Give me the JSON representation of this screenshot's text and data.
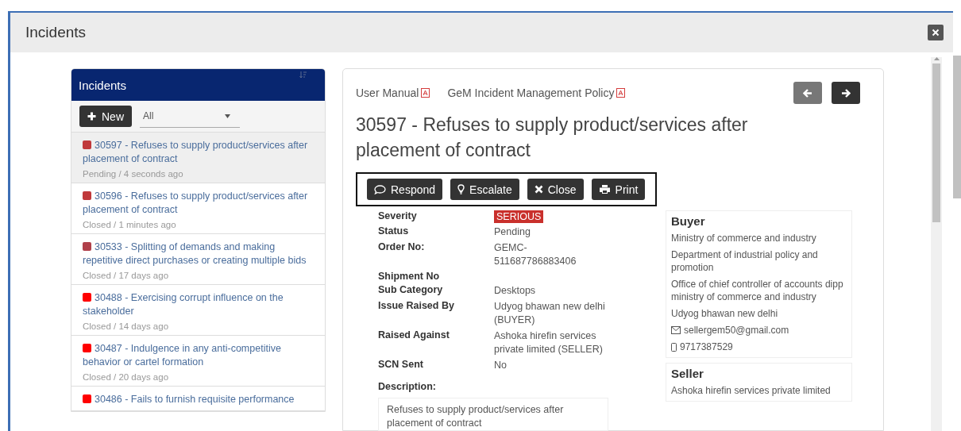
{
  "window": {
    "title": "Incidents"
  },
  "incident_list": {
    "title": "Incidents",
    "new_button": "New",
    "filter": {
      "value": "All"
    },
    "items": [
      {
        "title": "30597 - Refuses to supply product/services after placement of contract",
        "meta": "Pending / 4 seconds ago",
        "color": "#c0393b",
        "selected": true
      },
      {
        "title": "30596 - Refuses to supply product/services after placement of contract",
        "meta": "Closed / 1 minutes ago",
        "color": "#c0393b",
        "selected": false
      },
      {
        "title": "30533 - Splitting of demands and making repetitive direct purchases or creating multiple bids",
        "meta": "Closed / 17 days ago",
        "color": "#b0404a",
        "selected": false
      },
      {
        "title": "30488 - Exercising corrupt influence on the stakeholder",
        "meta": "Closed / 14 days ago",
        "color": "#ff0000",
        "selected": false
      },
      {
        "title": "30487 - Indulgence in any anti-competitive behavior or cartel formation",
        "meta": "Closed / 20 days ago",
        "color": "#ff0000",
        "selected": false
      },
      {
        "title": "30486 - Fails to furnish requisite performance",
        "color": "#ff0000",
        "selected": false
      }
    ]
  },
  "detail": {
    "links": [
      "User Manual",
      "GeM Incident Management Policy"
    ],
    "nav": [
      {
        "kind": "prev",
        "disabled": true
      },
      {
        "kind": "next",
        "disabled": false
      }
    ],
    "title": "30597 - Refuses to supply product/services after placement of contract",
    "actions": [
      {
        "label": "Respond",
        "kind": "respond"
      },
      {
        "label": "Escalate",
        "kind": "escalate"
      },
      {
        "label": "Close",
        "kind": "close"
      },
      {
        "label": "Print",
        "kind": "print"
      }
    ],
    "fields": [
      {
        "label": "Severity",
        "value": "SERIOUS",
        "kind": "badge"
      },
      {
        "label": "Status",
        "value": "Pending",
        "kind": "text"
      },
      {
        "label": "Order No:",
        "value": "GEMC-\n511687786883406",
        "kind": "text"
      },
      {
        "label": "Shipment No",
        "kind": "text"
      },
      {
        "label": "Sub Category",
        "value": "Desktops",
        "kind": "text"
      },
      {
        "label": "Issue Raised By",
        "value": "Udyog bhawan new delhi (BUYER)",
        "kind": "text"
      },
      {
        "label": "Raised Against",
        "value": "Ashoka hirefin services private limited (SELLER)",
        "kind": "text"
      },
      {
        "label": "SCN Sent",
        "value": "No",
        "kind": "text"
      }
    ],
    "description_label": "Description:",
    "description": "Refuses to supply product/services after placement of contract",
    "buyer": {
      "title": "Buyer",
      "lines": [
        "Ministry of commerce and industry",
        "Department of industrial policy and promotion",
        "Office of chief controller of accounts dipp ministry of commerce and industry",
        "Udyog bhawan new delhi"
      ],
      "email": "sellergem50@gmail.com",
      "phone": "9717387529"
    },
    "seller": {
      "title": "Seller",
      "lines": [
        "Ashoka hirefin services private limited"
      ]
    }
  }
}
